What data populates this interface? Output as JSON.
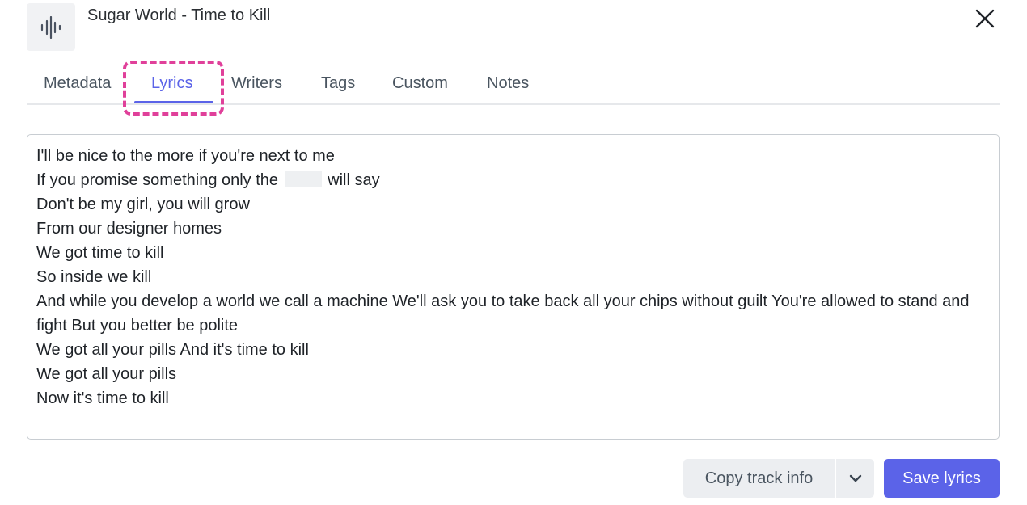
{
  "header": {
    "title": "Sugar World - Time to Kill",
    "icon": "audio-waveform-icon",
    "close_icon": "close-icon"
  },
  "tabs": [
    {
      "label": "Metadata",
      "active": false
    },
    {
      "label": "Lyrics",
      "active": true
    },
    {
      "label": "Writers",
      "active": false
    },
    {
      "label": "Tags",
      "active": false
    },
    {
      "label": "Custom",
      "active": false
    },
    {
      "label": "Notes",
      "active": false
    }
  ],
  "lyrics": {
    "lines": [
      {
        "text": "I'll be nice to the more if you're next to me"
      },
      {
        "before": "If you promise something only the",
        "after": "will say"
      },
      {
        "text": "Don't be my girl, you will grow"
      },
      {
        "text": "From our designer homes"
      },
      {
        "text": "We got time to kill"
      },
      {
        "text": "So inside we kill"
      },
      {
        "text": "And while you develop a world we call a machine We'll ask you to take back all your chips without guilt You're allowed to stand and fight But you better be polite"
      },
      {
        "text": "We got all your pills And it's time to kill"
      },
      {
        "text": "We got all your pills"
      },
      {
        "text": "Now it's time to kill"
      }
    ]
  },
  "footer": {
    "copy_label": "Copy track info",
    "dropdown_icon": "chevron-down-icon",
    "save_label": "Save lyrics"
  },
  "colors": {
    "accent": "#5b63e8",
    "highlight": "#e0409a"
  }
}
